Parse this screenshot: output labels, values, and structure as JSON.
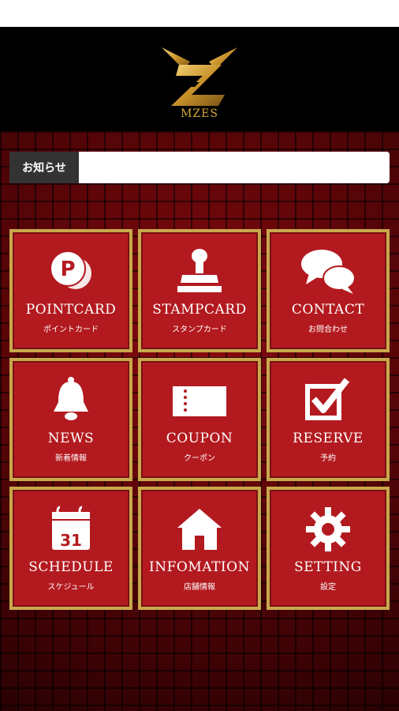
{
  "header": {
    "logo_text": "MZES"
  },
  "notice": {
    "label": "お知らせ",
    "content": ""
  },
  "menu": [
    {
      "label": "POINTCARD",
      "sub": "ポイントカード",
      "icon": "point-icon"
    },
    {
      "label": "STAMPCARD",
      "sub": "スタンプカード",
      "icon": "stamp-icon"
    },
    {
      "label": "CONTACT",
      "sub": "お問合わせ",
      "icon": "chat-bubbles-icon"
    },
    {
      "label": "NEWS",
      "sub": "新着情報",
      "icon": "bell-icon"
    },
    {
      "label": "COUPON",
      "sub": "クーポン",
      "icon": "ticket-icon"
    },
    {
      "label": "RESERVE",
      "sub": "予約",
      "icon": "checkbox-icon"
    },
    {
      "label": "SCHEDULE",
      "sub": "スケジュール",
      "icon": "calendar-icon"
    },
    {
      "label": "INFOMATION",
      "sub": "店舗情報",
      "icon": "house-icon"
    },
    {
      "label": "SETTING",
      "sub": "設定",
      "icon": "gear-icon"
    }
  ],
  "calendar_day": "31",
  "colors": {
    "tile_bg": "#b31a1f",
    "tile_border": "#c9a84c",
    "notice_label_bg": "#333333",
    "logo_gold": "#d7a93a"
  }
}
